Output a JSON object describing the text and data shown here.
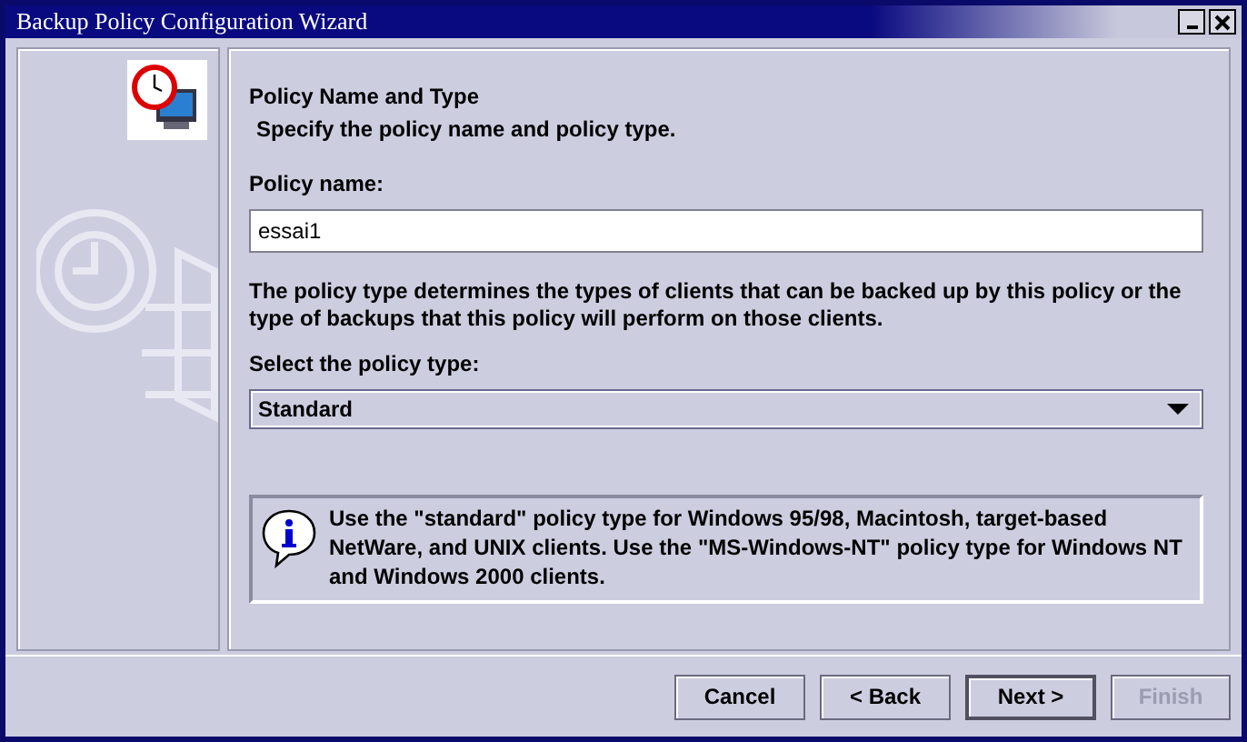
{
  "window": {
    "title": "Backup Policy Configuration Wizard"
  },
  "page": {
    "heading": "Policy Name and Type",
    "subheading": "Specify the policy name and policy type."
  },
  "policy_name": {
    "label": "Policy name:",
    "value": "essai1"
  },
  "description": "The policy type determines the types of clients that can be backed up by this policy or the type of backups that this policy will perform on those clients.",
  "policy_type": {
    "label": "Select the policy type:",
    "value": "Standard"
  },
  "info": "Use the \"standard\" policy type for Windows 95/98, Macintosh, target-based NetWare, and UNIX clients. Use the \"MS-Windows-NT\" policy type for Windows NT and Windows 2000 clients.",
  "buttons": [
    {
      "label": "Cancel",
      "disabled": false,
      "default": false
    },
    {
      "label": "< Back",
      "disabled": false,
      "default": false
    },
    {
      "label": "Next >",
      "disabled": false,
      "default": true
    },
    {
      "label": "Finish",
      "disabled": true,
      "default": false
    }
  ]
}
